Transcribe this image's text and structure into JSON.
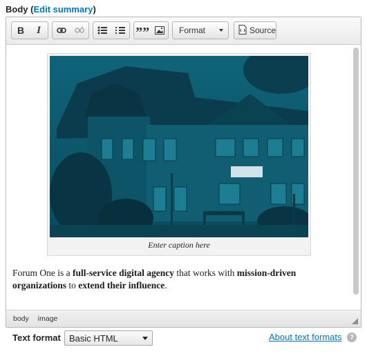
{
  "field": {
    "label": "Body",
    "open_paren": "(",
    "edit_summary": "Edit summary",
    "close_paren": ")"
  },
  "toolbar": {
    "bold": "B",
    "italic": "I",
    "blockquote": "””",
    "format_label": "Format",
    "source_label": "Source",
    "icons": [
      "bold-icon",
      "italic-icon",
      "link-icon",
      "unlink-icon",
      "bulleted-list-icon",
      "numbered-list-icon",
      "blockquote-icon",
      "image-icon",
      "source-icon"
    ]
  },
  "content": {
    "caption": "Enter caption here",
    "para": {
      "t1": "Forum One is a ",
      "b1": "full-service digital agency",
      "t2": " that works with ",
      "b2": "mission-driven organizations",
      "t3": " to ",
      "b3": "extend their influence",
      "t4": "."
    }
  },
  "pathbar": {
    "items": [
      "body",
      "image"
    ]
  },
  "text_format": {
    "label": "Text format",
    "selected": "Basic HTML",
    "about_link": "About text formats",
    "help": "?"
  },
  "colors": {
    "link": "#0074bd",
    "photo_tint": "#0d4e63"
  }
}
